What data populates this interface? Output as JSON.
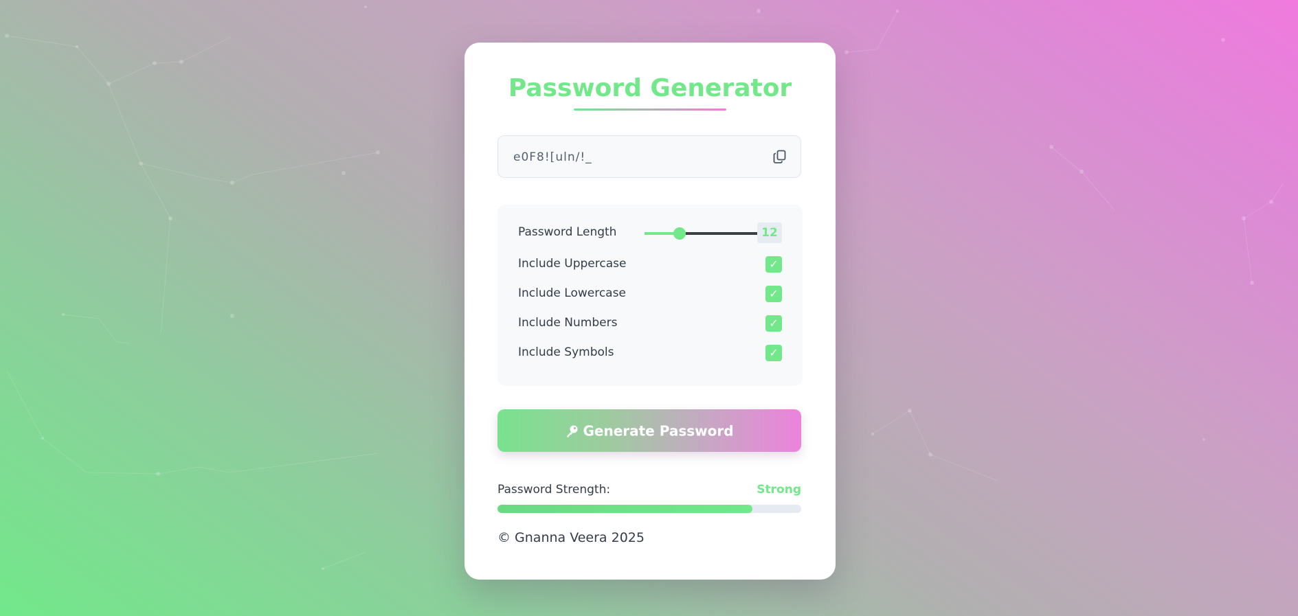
{
  "colors": {
    "accent_green": "#72e88a",
    "accent_pink": "#f07ade",
    "text_dark": "#333c48"
  },
  "app": {
    "title": "Password Generator"
  },
  "password": {
    "value": "e0F8![uln/!_",
    "copy_icon": "copy-icon"
  },
  "options": {
    "length_label": "Password Length",
    "length_value": "12",
    "length_min": 4,
    "length_max": 32,
    "items": [
      {
        "label": "Include Uppercase",
        "checked": true,
        "check_glyph": "✓"
      },
      {
        "label": "Include Lowercase",
        "checked": true,
        "check_glyph": "✓"
      },
      {
        "label": "Include Numbers",
        "checked": true,
        "check_glyph": "✓"
      },
      {
        "label": "Include Symbols",
        "checked": true,
        "check_glyph": "✓"
      }
    ]
  },
  "generate": {
    "label": "Generate Password",
    "icon": "key-icon"
  },
  "strength": {
    "label": "Password Strength:",
    "value": "Strong",
    "level_percent": 84
  },
  "footer": {
    "text": "© Gnanna Veera 2025"
  }
}
